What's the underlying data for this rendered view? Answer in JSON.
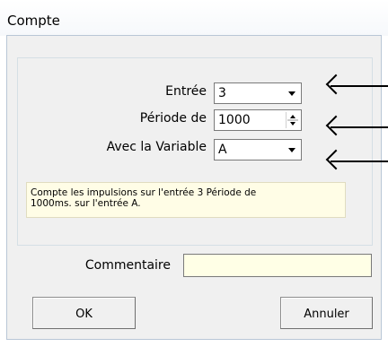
{
  "window": {
    "title": "Compte"
  },
  "fields": {
    "entree": {
      "label": "Entrée",
      "value": "3"
    },
    "periode": {
      "label": "Période de",
      "value": "1000"
    },
    "variable": {
      "label": "Avec la Variable",
      "value": "A"
    }
  },
  "info": {
    "line1": "Compte les impulsions sur l'entrée 3 Période de",
    "line2": "1000ms. sur l'entrée A."
  },
  "comment": {
    "label": "Commentaire",
    "value": ""
  },
  "buttons": {
    "ok": "OK",
    "cancel": "Annuler"
  },
  "icons": {
    "combo_arrow": "chevron-down-icon",
    "spinner": "spin-up-down-icon",
    "pointer_arrows": "arrow-left-icon"
  },
  "colors": {
    "dialog_bg": "#f0f0f0",
    "info_bg": "#fffde6",
    "comment_bg": "#ffffe6"
  }
}
